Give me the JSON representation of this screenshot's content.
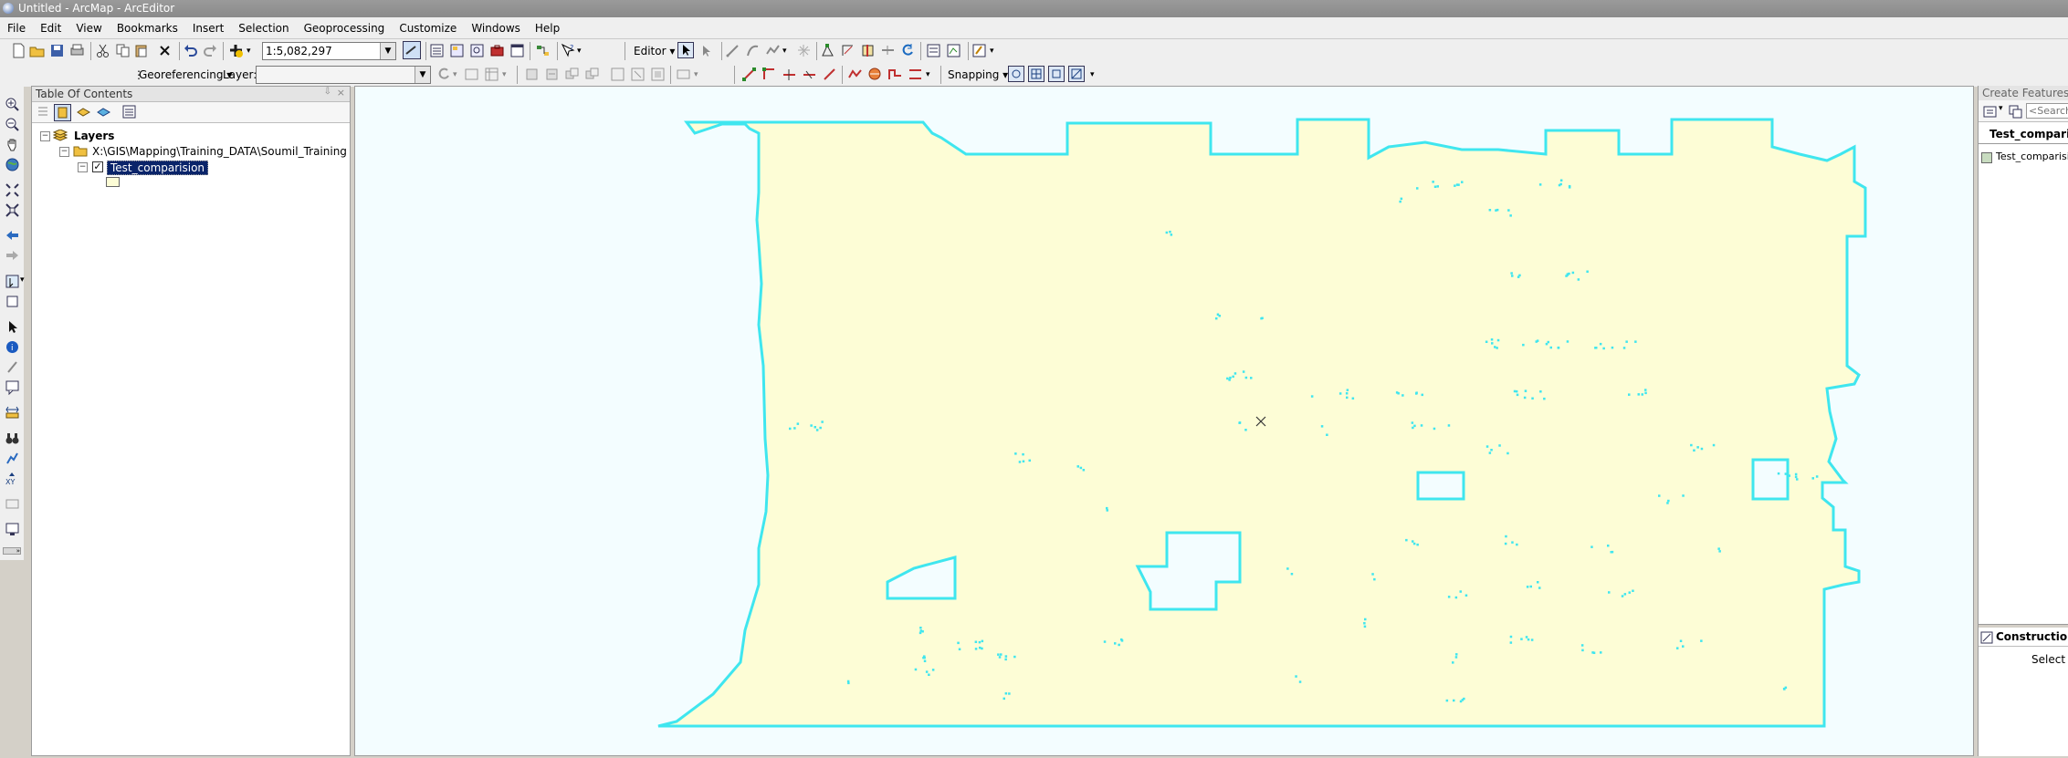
{
  "window": {
    "title": "Untitled - ArcMap - ArcEditor"
  },
  "menu": [
    "File",
    "Edit",
    "View",
    "Bookmarks",
    "Insert",
    "Selection",
    "Geoprocessing",
    "Customize",
    "Windows",
    "Help"
  ],
  "standard_toolbar": {
    "scale_value": "1:5,082,297"
  },
  "editor_toolbar": {
    "label": "Editor ▾"
  },
  "georef_toolbar": {
    "label": "Georeferencing ▾",
    "layer_label": "Layer:",
    "layer_value": ""
  },
  "snapping_toolbar": {
    "label": "Snapping ▾"
  },
  "toc": {
    "title": "Table Of Contents",
    "root": "Layers",
    "folder": "X:\\GIS\\Mapping\\Training_DATA\\Soumil_Training",
    "layer": "Test_comparision",
    "layer_checked": true
  },
  "create_features": {
    "title": "Create Features",
    "search_placeholder": "<Search>",
    "template_group": "Test_comparision",
    "template_item": "Test_comparision",
    "construction_title": "Construction T",
    "construction_text": "Select a"
  },
  "colors": {
    "polygon_fill": "#fdfdd6",
    "polygon_outline": "#3fe6ef",
    "map_background": "#f3fdff",
    "selection_highlight": "#0a246a"
  }
}
